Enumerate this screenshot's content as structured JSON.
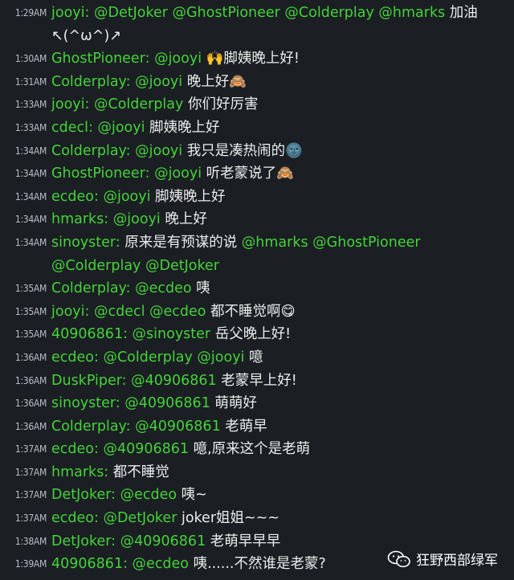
{
  "messages": [
    {
      "time": "1:29AM",
      "nick": "jooyi:",
      "mentions": "@DetJoker @GhostPioneer @Colderplay @hmarks",
      "text": " 加油 ↖(^ω^)↗"
    },
    {
      "time": "1:30AM",
      "nick": "GhostPioneer:",
      "mentions": "@jooyi",
      "text": " 🙌脚姨晚上好!"
    },
    {
      "time": "1:31AM",
      "nick": "Colderplay:",
      "mentions": "@jooyi",
      "text": " 晚上好🙈"
    },
    {
      "time": "1:33AM",
      "nick": "jooyi:",
      "mentions": "@Colderplay",
      "text": " 你们好厉害"
    },
    {
      "time": "1:33AM",
      "nick": "cdecl:",
      "mentions": "@jooyi",
      "text": " 脚姨晚上好"
    },
    {
      "time": "1:34AM",
      "nick": "Colderplay:",
      "mentions": "@jooyi",
      "text": " 我只是凑热闹的🌚"
    },
    {
      "time": "1:34AM",
      "nick": "GhostPioneer:",
      "mentions": "@jooyi",
      "text": " 听老蒙说了🙈"
    },
    {
      "time": "1:34AM",
      "nick": "ecdeo:",
      "mentions": "@jooyi",
      "text": " 脚姨晚上好"
    },
    {
      "time": "1:34AM",
      "nick": "hmarks:",
      "mentions": "@jooyi",
      "text": "  晚上好"
    },
    {
      "time": "1:34AM",
      "nick": "sinoyster:",
      "mentions": "",
      "text": " 原来是有预谋的说 ",
      "mentions2": "@hmarks @GhostPioneer @Colderplay @DetJoker"
    },
    {
      "time": "1:35AM",
      "nick": "Colderplay:",
      "mentions": "@ecdeo",
      "text": " 咦"
    },
    {
      "time": "1:35AM",
      "nick": "jooyi:",
      "mentions": "@cdecl @ecdeo",
      "text": " 都不睡觉啊😋"
    },
    {
      "time": "1:35AM",
      "nick": "40906861:",
      "mentions": "@sinoyster",
      "text": " 岳父晚上好!"
    },
    {
      "time": "1:36AM",
      "nick": "ecdeo:",
      "mentions": "@Colderplay  @jooyi",
      "text": " 噫"
    },
    {
      "time": "1:36AM",
      "nick": "DuskPiper:",
      "mentions": "@40906861",
      "text": " 老蒙早上好!"
    },
    {
      "time": "1:36AM",
      "nick": "sinoyster:",
      "mentions": "@40906861",
      "text": " 萌萌好"
    },
    {
      "time": "1:36AM",
      "nick": "Colderplay:",
      "mentions": "@40906861",
      "text": " 老萌早"
    },
    {
      "time": "1:37AM",
      "nick": "ecdeo:",
      "mentions": "@40906861",
      "text": " 噫,原来这个是老萌"
    },
    {
      "time": "1:37AM",
      "nick": "hmarks:",
      "mentions": "",
      "text": " 都不睡觉"
    },
    {
      "time": "1:37AM",
      "nick": "DetJoker:",
      "mentions": "@ecdeo",
      "text": " 咦~"
    },
    {
      "time": "1:37AM",
      "nick": "ecdeo:",
      "mentions": "@DetJoker",
      "text": " joker姐姐~~~"
    },
    {
      "time": "1:38AM",
      "nick": "DetJoker:",
      "mentions": "@40906861",
      "text": " 老萌早早早"
    },
    {
      "time": "1:39AM",
      "nick": "40906861:",
      "mentions": "@ecdeo",
      "text": " 咦......不然谁是老蒙?"
    }
  ],
  "watermark": {
    "label": "狂野西部绿军",
    "icon": "wechat-icon"
  },
  "colors": {
    "background": "#1b1f23",
    "nick": "#45d23a",
    "text": "#ececec",
    "time": "#b9bec4"
  }
}
